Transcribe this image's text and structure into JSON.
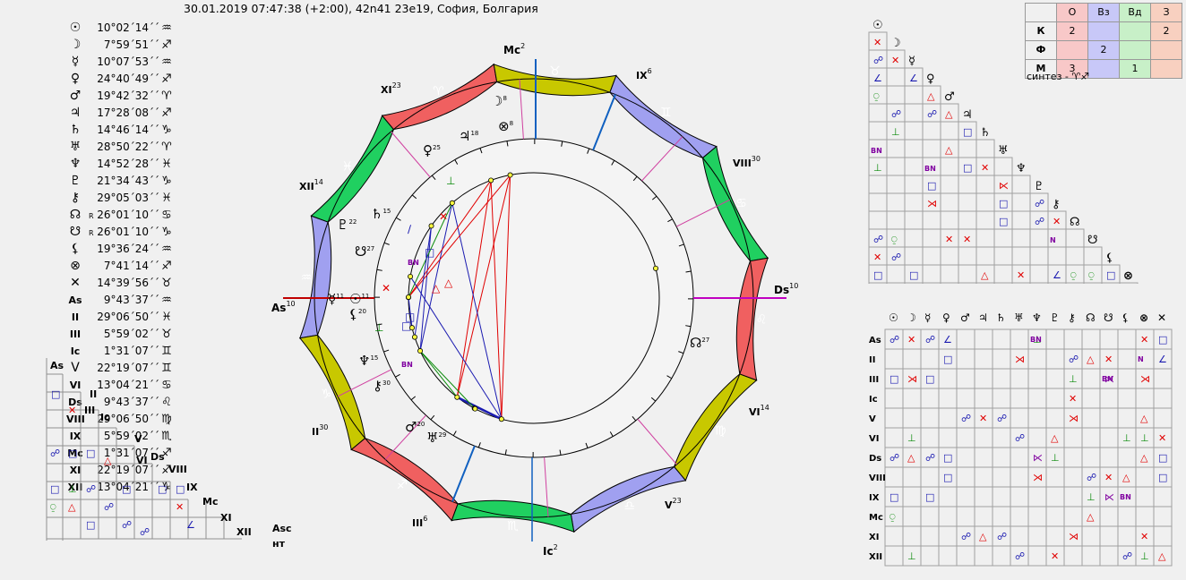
{
  "header": "30.01.2019 07:47:38 (+2:00), 42n41 23e19, София, Болгария",
  "planets": [
    {
      "glyph": "☉",
      "name": "Sun",
      "value": "10°02´14´´",
      "sign": "♒",
      "retro": ""
    },
    {
      "glyph": "☽",
      "name": "Moon",
      "value": "7°59´51´´",
      "sign": "♐",
      "retro": ""
    },
    {
      "glyph": "☿",
      "name": "Mercury",
      "value": "10°07´53´´",
      "sign": "♒",
      "retro": ""
    },
    {
      "glyph": "♀",
      "name": "Venus",
      "value": "24°40´49´´",
      "sign": "♐",
      "retro": ""
    },
    {
      "glyph": "♂",
      "name": "Mars",
      "value": "19°42´32´´",
      "sign": "♈",
      "retro": ""
    },
    {
      "glyph": "♃",
      "name": "Jupiter",
      "value": "17°28´08´´",
      "sign": "♐",
      "retro": ""
    },
    {
      "glyph": "♄",
      "name": "Saturn",
      "value": "14°46´14´´",
      "sign": "♑",
      "retro": ""
    },
    {
      "glyph": "♅",
      "name": "Uranus",
      "value": "28°50´22´´",
      "sign": "♈",
      "retro": ""
    },
    {
      "glyph": "♆",
      "name": "Neptune",
      "value": "14°52´28´´",
      "sign": "♓",
      "retro": ""
    },
    {
      "glyph": "♇",
      "name": "Pluto",
      "value": "21°34´43´´",
      "sign": "♑",
      "retro": ""
    },
    {
      "glyph": "⚷",
      "name": "Chiron",
      "value": "29°05´03´´",
      "sign": "♓",
      "retro": ""
    },
    {
      "glyph": "☊",
      "name": "North Node",
      "value": "26°01´10´´",
      "sign": "♋",
      "retro": "R"
    },
    {
      "glyph": "☋",
      "name": "South Node",
      "value": "26°01´10´´",
      "sign": "♑",
      "retro": "R"
    },
    {
      "glyph": "⚸",
      "name": "Lilith",
      "value": "19°36´24´´",
      "sign": "♒",
      "retro": ""
    },
    {
      "glyph": "⊗",
      "name": "Fortune",
      "value": "7°41´14´´",
      "sign": "♐",
      "retro": ""
    },
    {
      "glyph": "✕",
      "name": "Vertex",
      "value": "14°39´56´´",
      "sign": "♉",
      "retro": ""
    },
    {
      "glyph": "As",
      "name": "Ascendant",
      "value": "9°43´37´´",
      "sign": "♒",
      "retro": ""
    },
    {
      "glyph": "II",
      "name": "House II",
      "value": "29°06´50´´",
      "sign": "♓",
      "retro": ""
    },
    {
      "glyph": "III",
      "name": "House III",
      "value": "5°59´02´´",
      "sign": "♉",
      "retro": ""
    },
    {
      "glyph": "Ic",
      "name": "Imum Coeli",
      "value": "1°31´07´´",
      "sign": "♊",
      "retro": ""
    },
    {
      "glyph": "V",
      "name": "House V",
      "value": "22°19´07´´",
      "sign": "♊",
      "retro": ""
    },
    {
      "glyph": "VI",
      "name": "House VI",
      "value": "13°04´21´´",
      "sign": "♋",
      "retro": ""
    },
    {
      "glyph": "Ds",
      "name": "Descendant",
      "value": "9°43´37´´",
      "sign": "♌",
      "retro": ""
    },
    {
      "glyph": "VIII",
      "name": "House VIII",
      "value": "29°06´50´´",
      "sign": "♍",
      "retro": ""
    },
    {
      "glyph": "IX",
      "name": "House IX",
      "value": "5°59´02´´",
      "sign": "♏",
      "retro": ""
    },
    {
      "glyph": "Mc",
      "name": "Midheaven",
      "value": "1°31´07´´",
      "sign": "♐",
      "retro": ""
    },
    {
      "glyph": "XI",
      "name": "House XI",
      "value": "22°19´07´´",
      "sign": "♐",
      "retro": ""
    },
    {
      "glyph": "XII",
      "name": "House XII",
      "value": "13°04´21´´",
      "sign": "♑",
      "retro": ""
    }
  ],
  "asc_labels": {
    "line1": "Asc",
    "line2": "нт"
  },
  "elements_table": {
    "headers": [
      "",
      "О",
      "Вз",
      "Вд",
      "З"
    ],
    "rows": [
      {
        "label": "К",
        "cells": [
          "2",
          "",
          "",
          "2"
        ]
      },
      {
        "label": "Ф",
        "cells": [
          "",
          "2",
          "",
          ""
        ]
      },
      {
        "label": "М",
        "cells": [
          "3",
          "",
          "1",
          ""
        ]
      }
    ],
    "colors": [
      "#f8c8c8",
      "#c8c8f8",
      "#c8f0c8",
      "#f8d0c0"
    ]
  },
  "synthesis": "синтез - ♈♐",
  "chart": {
    "date_label": "30.01.2019 07:47:38",
    "axis_labels": {
      "mc": "Mc",
      "ic": "Ic",
      "asc": "As",
      "ds": "Ds"
    },
    "axis_degrees": {
      "mc": "2",
      "ic": "2",
      "asc": "10",
      "ds": "10"
    },
    "house_labels": [
      {
        "label": "XI",
        "deg": "23"
      },
      {
        "label": "IX",
        "deg": "6"
      },
      {
        "label": "VIII",
        "deg": "30"
      },
      {
        "label": "XII",
        "deg": "14"
      },
      {
        "label": "VI",
        "deg": "14"
      },
      {
        "label": "II",
        "deg": "30"
      },
      {
        "label": "III",
        "deg": "6"
      },
      {
        "label": "V",
        "deg": "23"
      }
    ],
    "planet_labels": [
      {
        "glyph": "☽",
        "deg": "8"
      },
      {
        "glyph": "⊗",
        "deg": "8"
      },
      {
        "glyph": "♃",
        "deg": "18"
      },
      {
        "glyph": "♀",
        "deg": "25"
      },
      {
        "glyph": "♄",
        "deg": "15"
      },
      {
        "glyph": "♇",
        "deg": "22"
      },
      {
        "glyph": "☋",
        "deg": "27"
      },
      {
        "glyph": "☿",
        "deg": "11"
      },
      {
        "glyph": "☉",
        "deg": "11"
      },
      {
        "glyph": "⚸",
        "deg": "20"
      },
      {
        "glyph": "♆",
        "deg": "15"
      },
      {
        "glyph": "⚷",
        "deg": "30"
      },
      {
        "glyph": "♂",
        "deg": "20"
      },
      {
        "glyph": "♅",
        "deg": "29"
      },
      {
        "glyph": "☊",
        "deg": "27"
      }
    ],
    "sign_colors": {
      "fire": "#f06060",
      "earth": "#c8c800",
      "air": "#a0a0f0",
      "water": "#20d060"
    }
  },
  "right_matrix": {
    "col_headers": [
      "☉",
      "☽",
      "☿",
      "♀",
      "♂",
      "♃",
      "♄",
      "♅",
      "♆",
      "♇",
      "⚷",
      "☊",
      "☋",
      "⚸",
      "⊗",
      "✕"
    ],
    "row_headers": [
      "As",
      "II",
      "III",
      "Ic",
      "V",
      "VI",
      "Ds",
      "VIII",
      "IX",
      "Mc",
      "XI",
      "XII"
    ]
  }
}
